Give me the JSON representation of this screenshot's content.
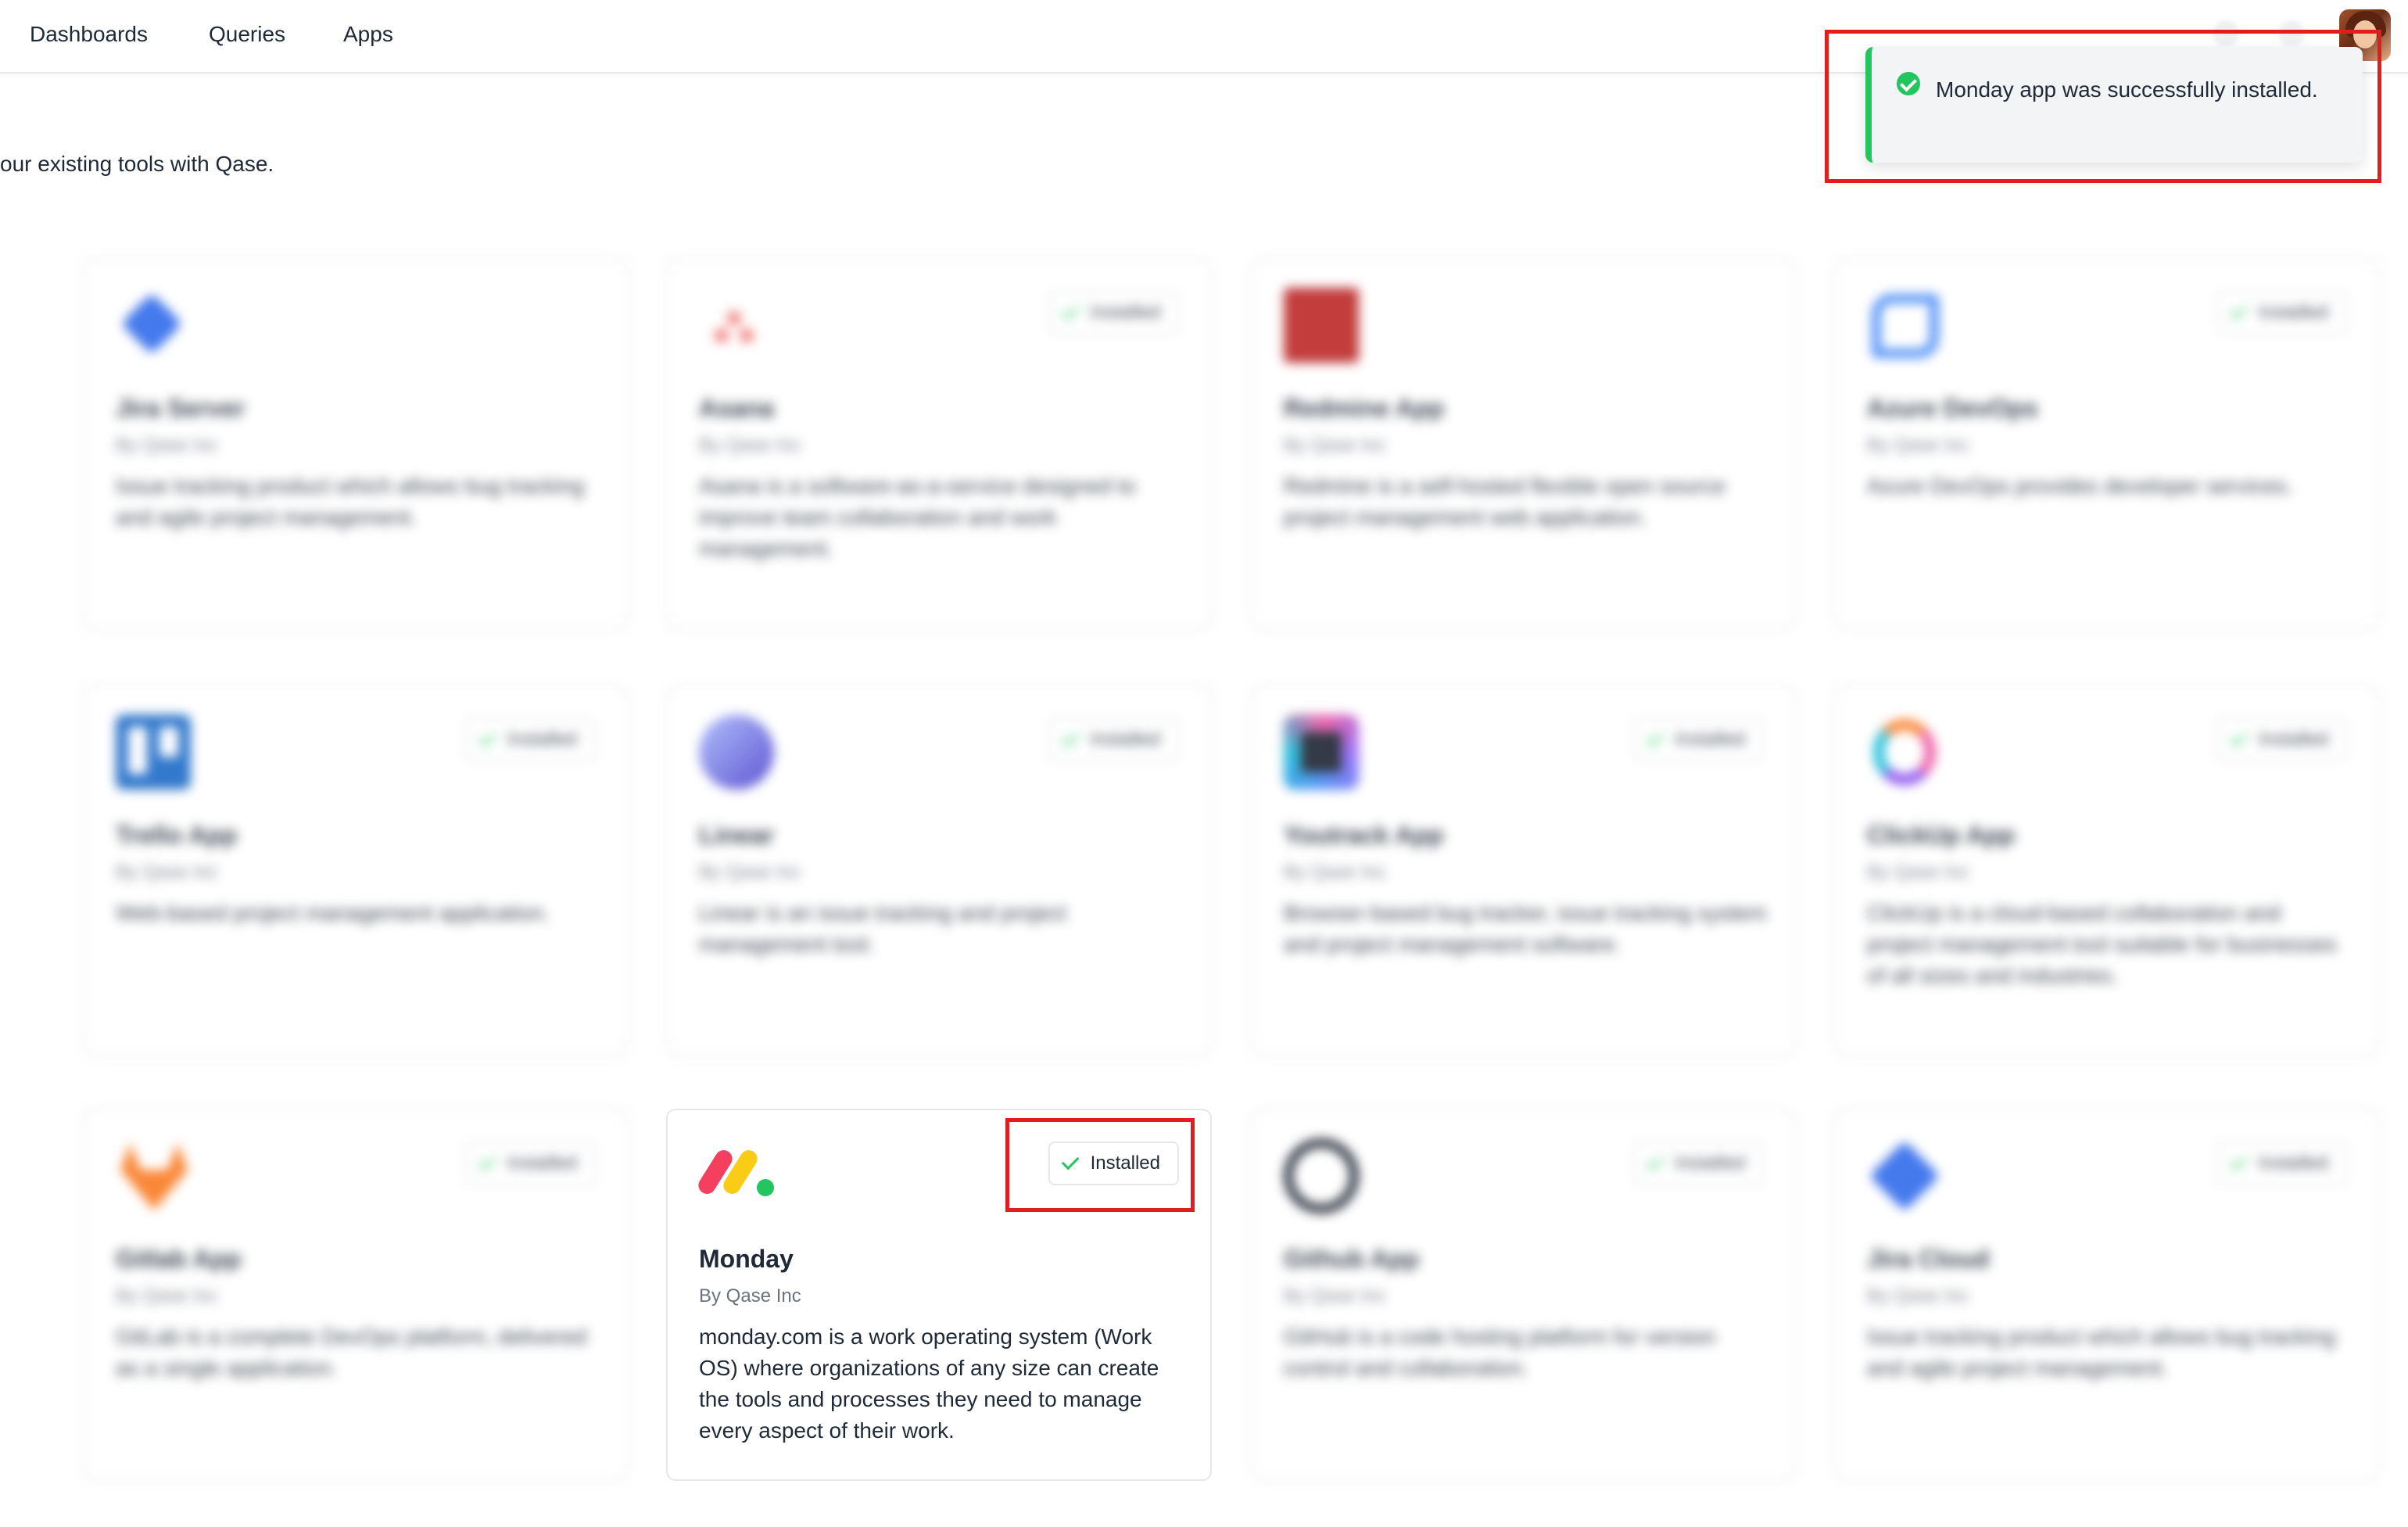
{
  "nav": {
    "items": [
      "Dashboards",
      "Queries",
      "Apps"
    ]
  },
  "page": {
    "subtitle": "our existing tools with Qase."
  },
  "toast": {
    "message": "Monday app was successfully installed.",
    "accent_color": "#22c55e",
    "icon": "check-circle-icon"
  },
  "apps": [
    {
      "name": "Jira Server",
      "by": "By Qase Inc",
      "description": "Issue tracking product which allows bug tracking and agile project management.",
      "installed": false,
      "icon": "jira-server-logo"
    },
    {
      "name": "Asana",
      "by": "By Qase Inc",
      "description": "Asana is a software-as-a-service designed to improve team collaboration and work management.",
      "installed": true,
      "icon": "asana-logo"
    },
    {
      "name": "Redmine App",
      "by": "By Qase Inc",
      "description": "Redmine is a self-hosted flexible open source project management web application.",
      "installed": false,
      "icon": "redmine-logo"
    },
    {
      "name": "Azure DevOps",
      "by": "By Qase Inc",
      "description": "Azure DevOps provides developer services.",
      "installed": true,
      "icon": "azure-devops-logo"
    },
    {
      "name": "Trello App",
      "by": "By Qase Inc",
      "description": "Web-based project management application.",
      "installed": true,
      "icon": "trello-logo"
    },
    {
      "name": "Linear",
      "by": "By Qase Inc",
      "description": "Linear is an issue tracking and project management tool.",
      "installed": true,
      "icon": "linear-logo"
    },
    {
      "name": "Youtrack App",
      "by": "By Qase Inc",
      "description": "Browser-based bug tracker, issue tracking system and project management software.",
      "installed": true,
      "icon": "youtrack-logo"
    },
    {
      "name": "ClickUp App",
      "by": "By Qase Inc",
      "description": "ClickUp is a cloud-based collaboration and project management tool suitable for businesses of all sizes and industries.",
      "installed": true,
      "icon": "clickup-logo"
    },
    {
      "name": "Gitlab App",
      "by": "By Qase Inc",
      "description": "GitLab is a complete DevOps platform, delivered as a single application.",
      "installed": true,
      "icon": "gitlab-logo"
    },
    {
      "name": "Monday",
      "by": "By Qase Inc",
      "description": "monday.com is a work operating system (Work OS) where organizations of any size can create the tools and processes they need to manage every aspect of their work.",
      "installed": true,
      "icon": "monday-logo"
    },
    {
      "name": "Github App",
      "by": "By Qase Inc",
      "description": "GitHub is a code hosting platform for version control and collaboration.",
      "installed": true,
      "icon": "github-logo"
    },
    {
      "name": "Jira Cloud",
      "by": "By Qase Inc",
      "description": "Issue tracking product which allows bug tracking and agile project management.",
      "installed": true,
      "icon": "jira-cloud-logo"
    }
  ],
  "installed_label": "Installed"
}
